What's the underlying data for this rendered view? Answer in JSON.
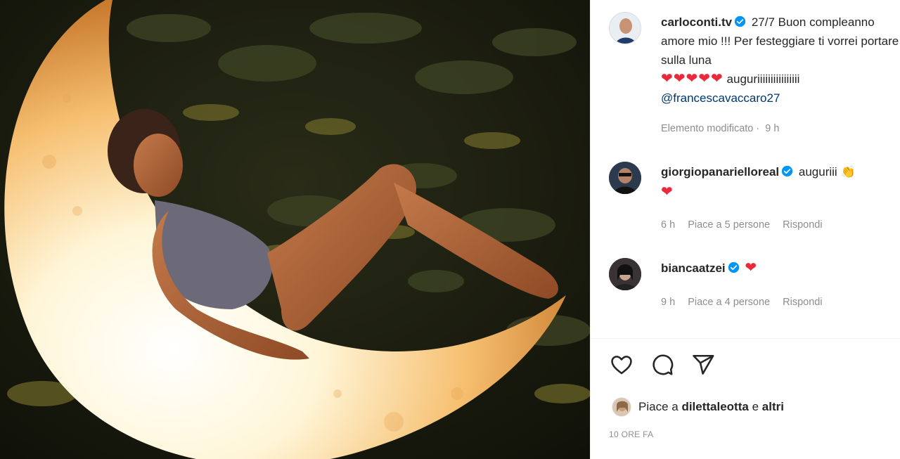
{
  "post": {
    "author": "carloconti.tv",
    "caption_text": "27/7 Buon compleanno amore mio !!! Per festeggiare ti vorrei portare sulla luna",
    "caption_hearts": "❤❤❤❤❤",
    "caption_tail": "auguriiiiiiiiiiiiiiii",
    "caption_mention": "@francescavaccaro27",
    "edited_label": "Elemento modificato",
    "edited_time": "9 h"
  },
  "comments": [
    {
      "username": "giorgiopanarielloreal",
      "text": "auguriii",
      "emoji": "👏",
      "heart": "❤",
      "time": "6 h",
      "likes": "Piace a 5 persone",
      "reply": "Rispondi"
    },
    {
      "username": "biancaatzei",
      "text": "",
      "heart": "❤",
      "time": "9 h",
      "likes": "Piace a 4 persone",
      "reply": "Rispondi"
    }
  ],
  "likes": {
    "prefix": "Piace a",
    "user": "dilettaleotta",
    "conj": "e",
    "others": "altri"
  },
  "timestamp": "10 ORE FA",
  "icons": {
    "like": "heart-outline-icon",
    "comment": "speech-bubble-icon",
    "share": "paper-plane-icon",
    "verified": "verified-badge-icon"
  },
  "colors": {
    "verified": "#0095f6",
    "heart": "#ed2939",
    "mention": "#00376b",
    "muted": "#8e8e8e"
  }
}
